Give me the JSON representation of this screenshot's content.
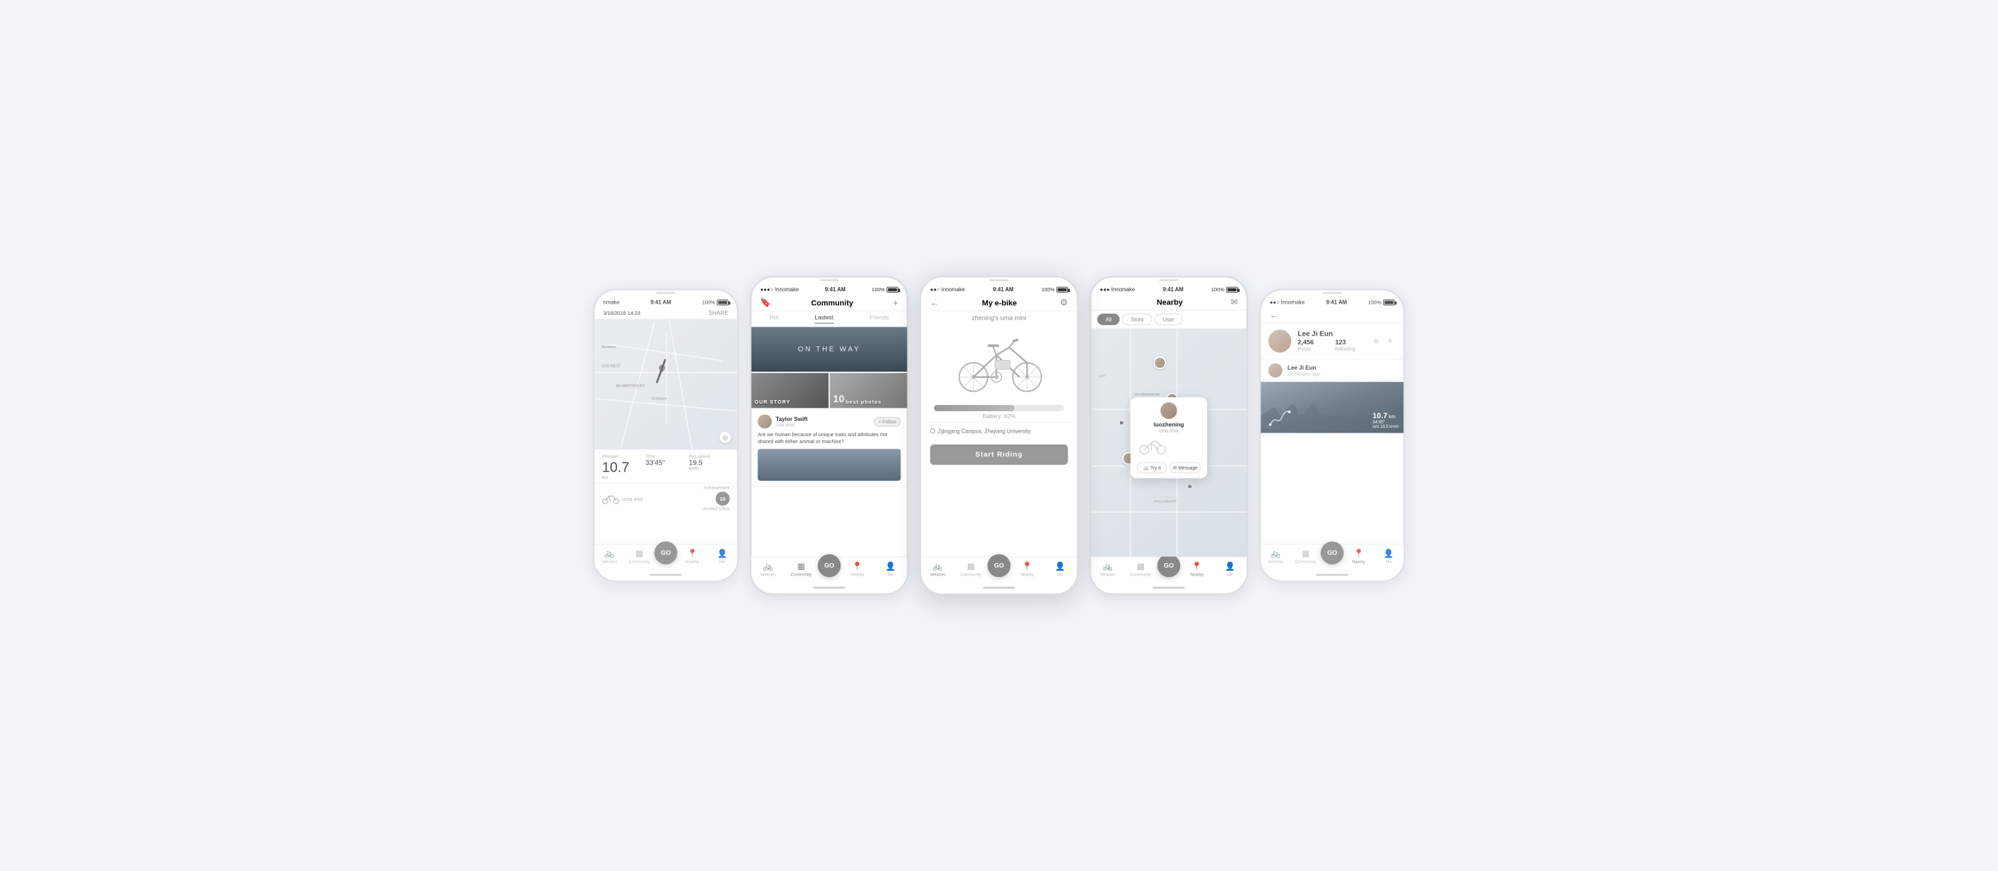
{
  "app": {
    "name": "innomake",
    "time": "9:41 AM",
    "battery": "100%",
    "signal": "●●●○○"
  },
  "phone1": {
    "status_left": "nmake",
    "status_signal": "●●●○",
    "date": "3/16/2016 14:23",
    "share_label": "SHARE",
    "mileage_label": "Mileage",
    "mileage_value": "10.7",
    "mileage_unit": "km",
    "time_label": "Time",
    "time_value": "33'45\"",
    "speed_label": "Avg.speed",
    "speed_value": "19.5",
    "speed_unit": "km/h",
    "bike_label": "uma mini",
    "achievement_label": "Achievement",
    "achievement_value": "10",
    "exceed_label": "exceed 10km"
  },
  "phone2": {
    "status_left": "●●●○ Innomake",
    "nav_title": "Community",
    "tab_hot": "Hot",
    "tab_latest": "Lastest",
    "tab_friends": "Friends",
    "tab_active": "Lastest",
    "hero_text": "ON THE WAY",
    "card1_label": "OUR STORY",
    "card2_num": "10",
    "card2_label": "best photos",
    "post_author": "Taylor Swift",
    "post_time": "Just now",
    "post_follow": "+ Follow",
    "post_text": "Are we human because of unique traits and attributes not shared with either animal or machine?",
    "tabs": [
      "Vehicles",
      "Community",
      "GO",
      "Nearby",
      "Me"
    ]
  },
  "phone3": {
    "status_left": "●●○ innomake",
    "nav_title": "My e-bike",
    "bike_name": "zhening's uma mini",
    "battery_percent": 62,
    "battery_label": "Battery: 62%",
    "location": "Zijingang Campus, Zhejiang University",
    "start_riding": "Start Riding",
    "tabs": [
      "Vehicles",
      "Community",
      "GO",
      "Nearby",
      "Me"
    ],
    "active_tab": "Vehicles"
  },
  "phone4": {
    "status_left": "●●● Innomake",
    "nav_title": "Nearby",
    "filter_all": "All",
    "filter_store": "Store",
    "filter_user": "User",
    "active_filter": "All",
    "popup_name": "luozhening",
    "popup_bike": "uma mini",
    "try_it": "Try it",
    "message": "Message",
    "tabs": [
      "Vehicles",
      "Community",
      "GO",
      "Nearby",
      "Me"
    ],
    "active_tab": "Nearby"
  },
  "phone5": {
    "status_left": "●●○ Innomake",
    "nav_back": "←",
    "profile_name": "Lee Ji Eun",
    "profile_posts": "2,456",
    "profile_posts_label": "Posts",
    "profile_following": "123",
    "profile_following_label": "following",
    "recent_post_name": "Lee Ji Eun",
    "recent_post_time": "20 minutes ago",
    "ride_km": "10.7",
    "ride_km_unit": "km",
    "ride_time": "34'45\"",
    "ride_speed_unit": "m/s  18.5 km/h",
    "tabs": [
      "Vehicles",
      "Community",
      "GO",
      "Nearby",
      "Me"
    ],
    "active_tab": "Nearby"
  }
}
